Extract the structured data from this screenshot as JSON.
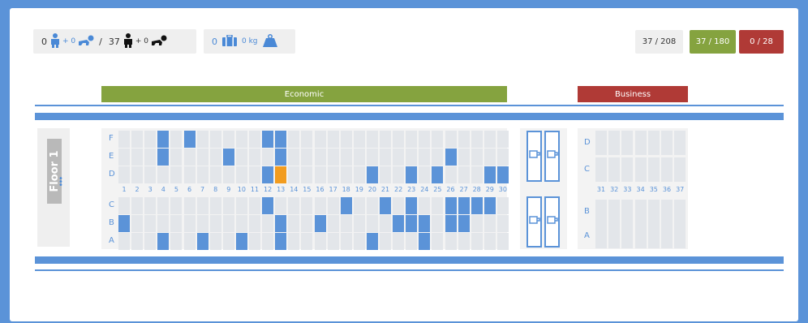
{
  "stats": {
    "adults_booked": "0",
    "plus_infants_booked": "+ 0",
    "separator": "/",
    "adults_total": "37",
    "plus_infants_total": "+ 0",
    "bags_count": "0",
    "bags_weight": "0 kg",
    "total_seats": "37 / 208",
    "economic_seats": "37 / 180",
    "business_seats": "0 / 28"
  },
  "classes": {
    "economic": "Economic",
    "business": "Business"
  },
  "floor": {
    "label": "Floor 1"
  },
  "economy": {
    "rows_top": [
      "F",
      "E",
      "D"
    ],
    "rows_bottom": [
      "C",
      "B",
      "A"
    ],
    "columns": [
      "1",
      "2",
      "3",
      "4",
      "5",
      "6",
      "7",
      "8",
      "9",
      "10",
      "11",
      "12",
      "13",
      "14",
      "15",
      "16",
      "17",
      "18",
      "19",
      "20",
      "21",
      "22",
      "23",
      "24",
      "25",
      "26",
      "27",
      "28",
      "29",
      "30"
    ],
    "occupied": {
      "F": [
        4,
        6,
        12,
        13
      ],
      "E": [
        4,
        9,
        13,
        26
      ],
      "D": [
        12,
        20,
        23,
        25,
        29,
        30
      ],
      "C": [
        12,
        18,
        21,
        23,
        26,
        27,
        28,
        29
      ],
      "B": [
        1,
        13,
        16,
        22,
        23,
        24,
        26,
        27
      ],
      "A": [
        4,
        7,
        10,
        13,
        20,
        24
      ]
    },
    "selected": {
      "D": [
        13
      ]
    }
  },
  "business": {
    "rows_top": [
      "D",
      "C"
    ],
    "rows_bottom": [
      "B",
      "A"
    ],
    "columns": [
      "31",
      "32",
      "33",
      "34",
      "35",
      "36",
      "37"
    ]
  },
  "colors": {
    "occupied": "#5b93d8",
    "selected": "#f29c1f",
    "free": "#e3e6ea",
    "economic": "#85a33f",
    "business": "#b03a36"
  }
}
